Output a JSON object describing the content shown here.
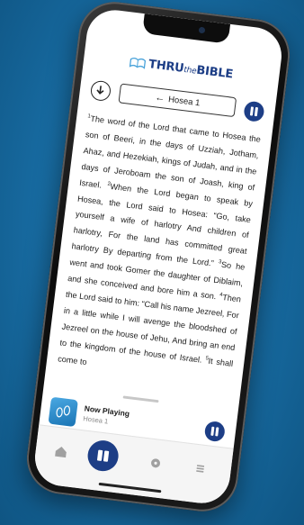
{
  "app": {
    "logo_main": "THRU",
    "logo_small": "the",
    "logo_tail": "BIBLE"
  },
  "nav": {
    "chapter_label": "Hosea 1",
    "back_arrow": "←",
    "download_icon": "download-icon",
    "pause_icon": "pause-icon"
  },
  "scripture": {
    "verses": [
      {
        "num": "1",
        "text": "The word of the Lord that came to Hosea the son of Beeri, in the days of Uzziah, Jotham, Ahaz, and Hezekiah, kings of Judah, and in the days of Jeroboam the son of Joash, king of Israel. "
      },
      {
        "num": "2",
        "text": "When the Lord began to speak by Hosea, the Lord said to Hosea: “Go, take yourself a wife of harlotry And children of harlotry, For the land has committed great harlotry By departing from the Lord.” "
      },
      {
        "num": "3",
        "text": "So he went and took Gomer the daughter of Diblaim, and she conceived and bore him a son. "
      },
      {
        "num": "4",
        "text": "Then the Lord said to him: “Call his name Jezreel, For in a little while I will avenge the bloodshed of Jezreel on the house of Jehu, And bring an end to the kingdom of the house of Israel. "
      },
      {
        "num": "5",
        "text": "It shall come to"
      }
    ]
  },
  "player": {
    "title": "Now Playing",
    "subtitle": "Hosea 1",
    "progress": 0.05,
    "thumb_icon": "footprints-icon",
    "pause_icon": "pause-icon"
  },
  "tabbar": {
    "items": [
      {
        "name": "home",
        "icon": "home-icon",
        "glyph": "⌂"
      },
      {
        "name": "read",
        "icon": "book-icon",
        "glyph": "▮▮"
      },
      {
        "name": "explore",
        "icon": "compass-icon",
        "glyph": "●"
      },
      {
        "name": "menu",
        "icon": "menu-icon",
        "glyph": "≡"
      }
    ]
  },
  "colors": {
    "brand": "#1d3e86",
    "background": "#176aa0"
  }
}
